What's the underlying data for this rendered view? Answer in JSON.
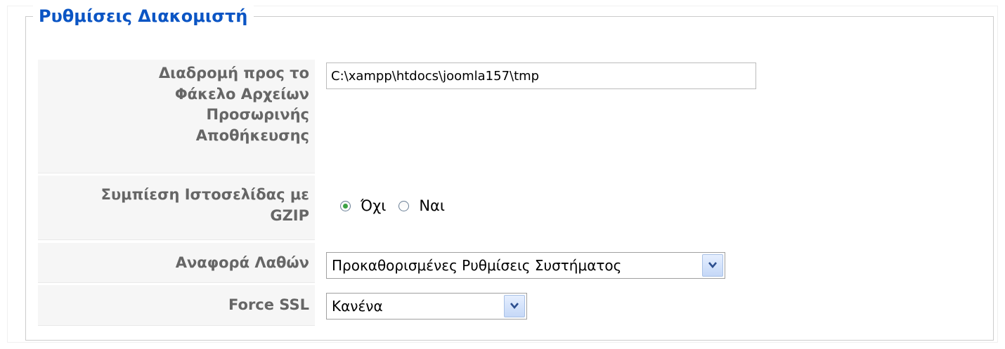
{
  "fieldset": {
    "legend": "Ρυθμίσεις Διακομιστή"
  },
  "temp_folder": {
    "label": "Διαδρομή προς το Φάκελο Αρχείων Προσωρινής Αποθήκευσης",
    "value": "C:\\xampp\\htdocs\\joomla157\\tmp"
  },
  "gzip": {
    "label": "Συμπίεση Ιστοσελίδας με GZIP",
    "options": [
      {
        "label": "Όχι",
        "checked": true
      },
      {
        "label": "Ναι",
        "checked": false
      }
    ]
  },
  "error_reporting": {
    "label": "Αναφορά Λαθών",
    "selected": "Προκαθορισμένες Ρυθμίσεις Συστήματος"
  },
  "force_ssl": {
    "label": "Force SSL",
    "selected": "Κανένα"
  },
  "icons": {
    "dropdown": "chevron-down-icon",
    "radio": "radio-icon"
  },
  "colors": {
    "legend": "#0b55c4",
    "label_text": "#666666",
    "label_bg": "#f6f6f6",
    "radio_checked": "#3da244"
  }
}
